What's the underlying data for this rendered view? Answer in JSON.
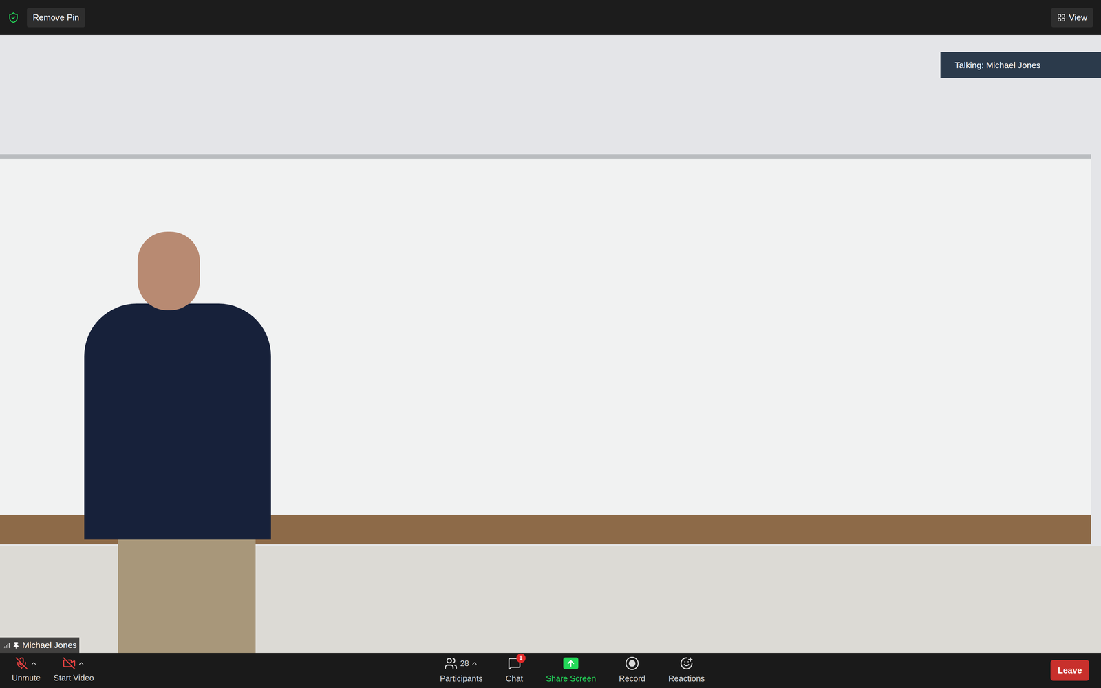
{
  "top_bar": {
    "pin_button": "Remove Pin",
    "view_button": "View"
  },
  "video": {
    "speaker_overlay": "Talking: Michael Jones",
    "name_tag": "Michael Jones",
    "pinned": true
  },
  "toolbar": {
    "audio": {
      "label": "Unmute",
      "muted": true
    },
    "camera": {
      "label": "Start Video",
      "off": true
    },
    "center": [
      {
        "kind": "participants",
        "label": "Participants",
        "count": "28"
      },
      {
        "kind": "chat",
        "label": "Chat",
        "badge": "1"
      },
      {
        "kind": "share",
        "label": "Share Screen"
      },
      {
        "kind": "record",
        "label": "Record"
      },
      {
        "kind": "reactions",
        "label": "Reactions"
      }
    ],
    "leave": "Leave"
  }
}
